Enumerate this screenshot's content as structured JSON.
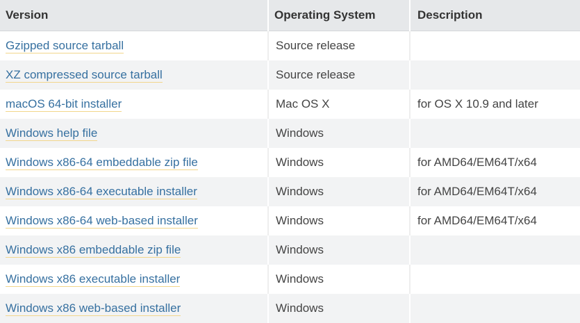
{
  "table": {
    "headers": {
      "version": "Version",
      "os": "Operating System",
      "description": "Description"
    },
    "rows": [
      {
        "version": "Gzipped source tarball",
        "os": "Source release",
        "description": ""
      },
      {
        "version": "XZ compressed source tarball",
        "os": "Source release",
        "description": ""
      },
      {
        "version": "macOS 64-bit installer",
        "os": "Mac OS X",
        "description": "for OS X 10.9 and later"
      },
      {
        "version": "Windows help file",
        "os": "Windows",
        "description": ""
      },
      {
        "version": "Windows x86-64 embeddable zip file",
        "os": "Windows",
        "description": "for AMD64/EM64T/x64"
      },
      {
        "version": "Windows x86-64 executable installer",
        "os": "Windows",
        "description": "for AMD64/EM64T/x64"
      },
      {
        "version": "Windows x86-64 web-based installer",
        "os": "Windows",
        "description": "for AMD64/EM64T/x64"
      },
      {
        "version": "Windows x86 embeddable zip file",
        "os": "Windows",
        "description": ""
      },
      {
        "version": "Windows x86 executable installer",
        "os": "Windows",
        "description": ""
      },
      {
        "version": "Windows x86 web-based installer",
        "os": "Windows",
        "description": ""
      }
    ]
  },
  "colors": {
    "link": "#3670a0",
    "link_underline": "#f2d68b",
    "header_bg": "#e6e8ea",
    "stripe_bg": "#f2f3f4"
  }
}
